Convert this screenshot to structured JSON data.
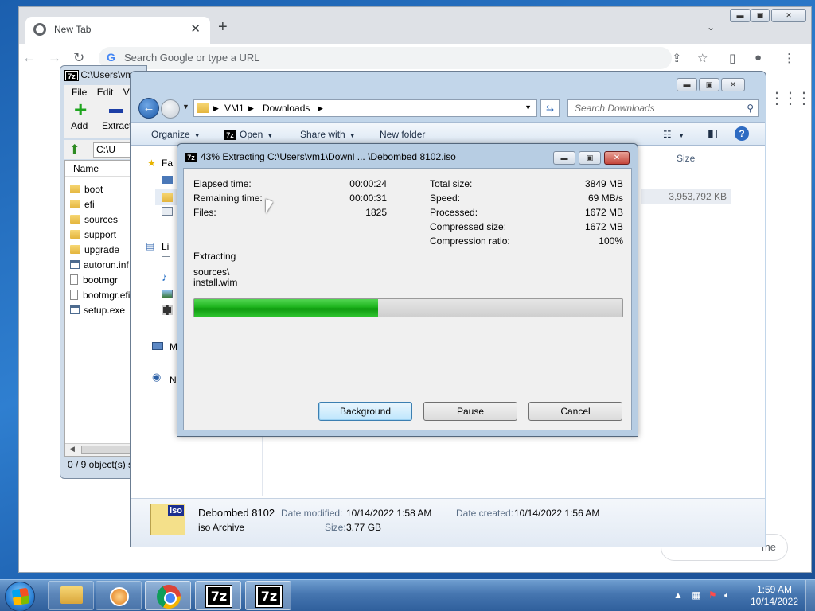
{
  "chrome": {
    "tab_title": "New Tab",
    "tab_close": "✕",
    "new_tab": "+",
    "omnibox_placeholder": "Search Google or type a URL",
    "pill_text": "me"
  },
  "zip_fm": {
    "title": "C:\\Users\\vm1",
    "menu": [
      "File",
      "Edit",
      "V"
    ],
    "add_label": "Add",
    "extract_label": "Extract",
    "path": "C:\\U",
    "column_name": "Name",
    "items": [
      {
        "name": "boot",
        "kind": "folder"
      },
      {
        "name": "efi",
        "kind": "folder"
      },
      {
        "name": "sources",
        "kind": "folder"
      },
      {
        "name": "support",
        "kind": "folder"
      },
      {
        "name": "upgrade",
        "kind": "folder"
      },
      {
        "name": "autorun.inf",
        "kind": "file"
      },
      {
        "name": "bootmgr",
        "kind": "file"
      },
      {
        "name": "bootmgr.efi",
        "kind": "file"
      },
      {
        "name": "setup.exe",
        "kind": "exe"
      }
    ],
    "status": "0 / 9 object(s) s"
  },
  "explorer": {
    "breadcrumb": [
      "VM1",
      "Downloads"
    ],
    "search_placeholder": "Search Downloads",
    "commands": {
      "organize": "Organize",
      "open": "Open",
      "share_with": "Share with",
      "new_folder": "New folder"
    },
    "nav_items": {
      "favorites": "Fa",
      "libraries": "Li",
      "computer": "M",
      "network": "N"
    },
    "column_size": "Size",
    "selected_size": "3,953,792 KB",
    "details": {
      "name": "Debombed 8102",
      "type": "iso Archive",
      "date_modified_label": "Date modified:",
      "date_modified": "10/14/2022 1:58 AM",
      "size_label": "Size:",
      "size": "3.77 GB",
      "date_created_label": "Date created:",
      "date_created": "10/14/2022 1:56 AM",
      "icon_text": "iso"
    }
  },
  "dialog": {
    "title": "43% Extracting C:\\Users\\vm1\\Downl ... \\Debombed 8102.iso",
    "progress_percent": 43,
    "left_stats": [
      {
        "label": "Elapsed time:",
        "value": "00:00:24"
      },
      {
        "label": "Remaining time:",
        "value": "00:00:31"
      },
      {
        "label": "Files:",
        "value": "1825"
      }
    ],
    "right_stats": [
      {
        "label": "Total size:",
        "value": "3849 MB"
      },
      {
        "label": "Speed:",
        "value": "69 MB/s"
      },
      {
        "label": "Processed:",
        "value": "1672 MB"
      },
      {
        "label": "Compressed size:",
        "value": "1672 MB"
      },
      {
        "label": "Compression ratio:",
        "value": "100%"
      }
    ],
    "operation": "Extracting",
    "current_path": "sources\\",
    "current_file": "install.wim",
    "buttons": {
      "background": "Background",
      "pause": "Pause",
      "cancel": "Cancel"
    }
  },
  "taskbar": {
    "time": "1:59 AM",
    "date": "10/14/2022",
    "z7_label": "7z"
  }
}
